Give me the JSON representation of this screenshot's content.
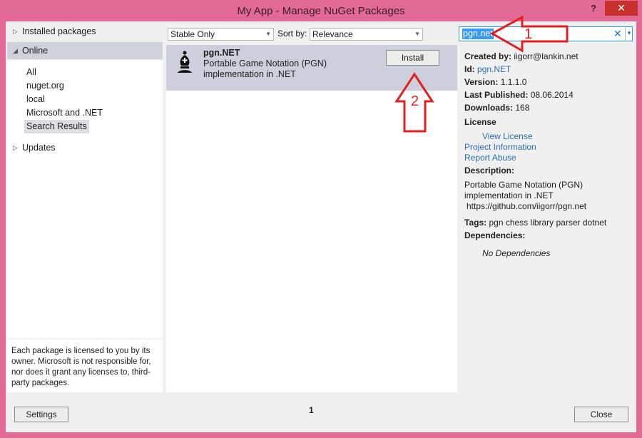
{
  "window": {
    "title": "My App - Manage NuGet Packages",
    "help": "?",
    "close": "✕"
  },
  "tree": {
    "installed": "Installed packages",
    "online": "Online",
    "online_items": [
      "All",
      "nuget.org",
      "local",
      "Microsoft and .NET",
      "Search Results"
    ],
    "updates": "Updates"
  },
  "left_note": "Each package is licensed to you by its owner. Microsoft is not responsible for, nor does it grant any licenses to, third-party packages.",
  "filter": {
    "stable": "Stable Only",
    "sort_label": "Sort by:",
    "sort_value": "Relevance"
  },
  "package": {
    "name": "pgn.NET",
    "desc_line1": "Portable Game Notation (PGN)",
    "desc_line2": "implementation in .NET",
    "install": "Install"
  },
  "pager": {
    "page": "1"
  },
  "search": {
    "value": "pgn.net"
  },
  "details": {
    "created_by_label": "Created by:",
    "created_by": "iigorr@lankin.net",
    "id_label": "Id:",
    "id": "pgn.NET",
    "version_label": "Version:",
    "version": "1.1.1.0",
    "published_label": "Last Published:",
    "published": "08.06.2014",
    "downloads_label": "Downloads:",
    "downloads": "168",
    "license_label": "License",
    "view_license": "View License",
    "project_info": "Project Information",
    "report_abuse": "Report Abuse",
    "description_label": "Description:",
    "description_line1": "Portable Game Notation (PGN)",
    "description_line2": "implementation in .NET",
    "description_line3": "https://github.com/iigorr/pgn.net",
    "tags_label": "Tags:",
    "tags": "pgn chess library parser dotnet",
    "dependencies_label": "Dependencies:",
    "no_deps": "No Dependencies"
  },
  "footer": {
    "settings": "Settings",
    "close": "Close"
  },
  "annotations": {
    "one": "1",
    "two": "2"
  },
  "colors": {
    "frame": "#e36a97",
    "accent": "#2b6db3",
    "annotation": "#e02020",
    "close_button": "#c7312b"
  }
}
